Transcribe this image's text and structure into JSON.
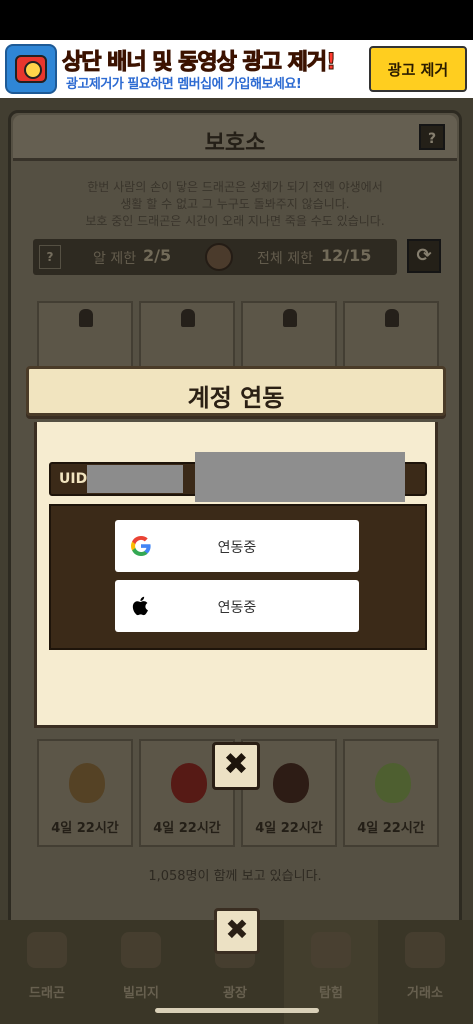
{
  "ad": {
    "title": "상단 배너 및 동영상 광고 제거!",
    "subtitle": "광고제거가 필요하면 멤버십에 가입해보세요!",
    "button": "광고 제거"
  },
  "shelter": {
    "title": "보호소",
    "help": "?",
    "notice_line1": "한번 사람의 손이 닿은 드래곤은 성체가 되기 전엔 야생에서",
    "notice_line2": "생활 할 수 없고 그 누구도 돌봐주지 않습니다.",
    "notice_line3": "보호 중인 드래곤은 시간이 오래 지나면 죽을 수도 있습니다.",
    "egg_limit_label": "알 제한",
    "egg_limit_value": "2/5",
    "total_limit_label": "전체 제한",
    "total_limit_value": "12/15",
    "slot_times": [
      "4일 22시간",
      "4일 22시간",
      "4일 22시간",
      "4일 22시간"
    ],
    "viewers": "1,058명이 함께 보고 있습니다."
  },
  "nav": {
    "items": [
      "드래곤",
      "빌리지",
      "광장",
      "탐험",
      "거래소"
    ],
    "active_index": 3
  },
  "modal": {
    "title": "계정 연동",
    "uid_label": "UID",
    "google": {
      "icon": "google-icon",
      "status": "연동중"
    },
    "apple": {
      "icon": "apple-icon",
      "status": "연동중"
    },
    "close": "✖"
  }
}
